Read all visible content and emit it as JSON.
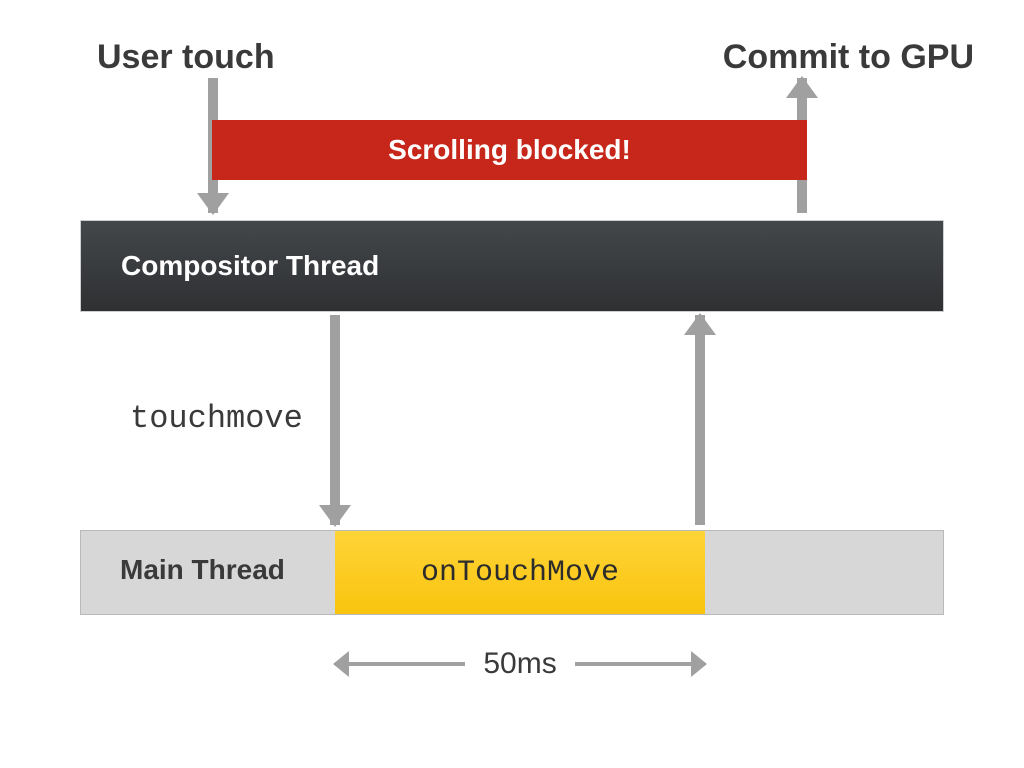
{
  "labels": {
    "user_touch": "User touch",
    "commit_gpu": "Commit to GPU",
    "scrolling_blocked": "Scrolling blocked!",
    "compositor_thread": "Compositor Thread",
    "touchmove": "touchmove",
    "main_thread": "Main Thread",
    "on_touch_move": "onTouchMove",
    "duration": "50ms"
  },
  "colors": {
    "blocked_bg": "#c7271a",
    "compositor_dark": "#2e3032",
    "main_thread_bg": "#d7d7d7",
    "ontouchmove_bg": "#f9c40e",
    "arrow": "#a0a0a0"
  },
  "diagram": {
    "type": "thread-timing",
    "duration_ms": 50,
    "flow": [
      "User touch",
      "Compositor Thread",
      "touchmove",
      "Main Thread onTouchMove (50ms)",
      "Compositor Thread",
      "Commit to GPU"
    ],
    "state": "Scrolling blocked!"
  }
}
